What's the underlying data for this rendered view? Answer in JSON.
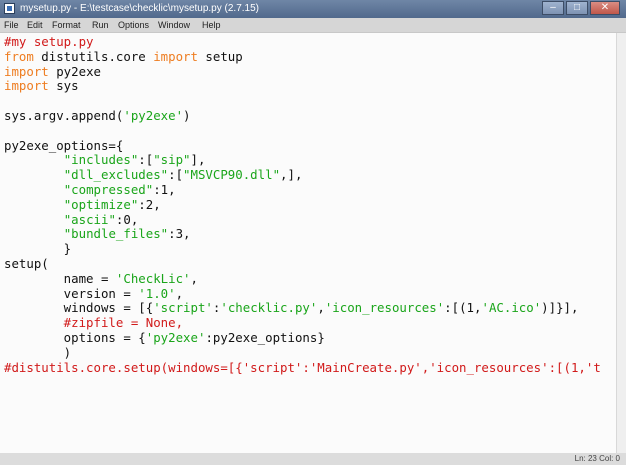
{
  "window": {
    "title": "mysetup.py - E:\\testcase\\checklic\\mysetup.py (2.7.15)",
    "buttons": {
      "minimize": "–",
      "maximize": "□",
      "close": "✕"
    }
  },
  "menu": [
    "File",
    "Edit",
    "Format",
    "Run",
    "Options",
    "Window",
    "Help"
  ],
  "code_lines": [
    [
      {
        "t": "#my setup.py",
        "c": "comment"
      }
    ],
    [
      {
        "t": "from",
        "c": "keyword"
      },
      {
        "t": " distutils.core ",
        "c": "normal"
      },
      {
        "t": "import",
        "c": "keyword"
      },
      {
        "t": " setup",
        "c": "normal"
      }
    ],
    [
      {
        "t": "import",
        "c": "keyword"
      },
      {
        "t": " py2exe",
        "c": "normal"
      }
    ],
    [
      {
        "t": "import",
        "c": "keyword"
      },
      {
        "t": " sys",
        "c": "normal"
      }
    ],
    [],
    [
      {
        "t": "sys.argv.append(",
        "c": "normal"
      },
      {
        "t": "'py2exe'",
        "c": "string"
      },
      {
        "t": ")",
        "c": "normal"
      }
    ],
    [],
    [
      {
        "t": "py2exe_options={",
        "c": "normal"
      }
    ],
    [
      {
        "t": "        ",
        "c": "normal"
      },
      {
        "t": "\"includes\"",
        "c": "string"
      },
      {
        "t": ":[",
        "c": "normal"
      },
      {
        "t": "\"sip\"",
        "c": "string"
      },
      {
        "t": "],",
        "c": "normal"
      }
    ],
    [
      {
        "t": "        ",
        "c": "normal"
      },
      {
        "t": "\"dll_excludes\"",
        "c": "string"
      },
      {
        "t": ":[",
        "c": "normal"
      },
      {
        "t": "\"MSVCP90.dll\"",
        "c": "string"
      },
      {
        "t": ",],",
        "c": "normal"
      }
    ],
    [
      {
        "t": "        ",
        "c": "normal"
      },
      {
        "t": "\"compressed\"",
        "c": "string"
      },
      {
        "t": ":1,",
        "c": "normal"
      }
    ],
    [
      {
        "t": "        ",
        "c": "normal"
      },
      {
        "t": "\"optimize\"",
        "c": "string"
      },
      {
        "t": ":2,",
        "c": "normal"
      }
    ],
    [
      {
        "t": "        ",
        "c": "normal"
      },
      {
        "t": "\"ascii\"",
        "c": "string"
      },
      {
        "t": ":0,",
        "c": "normal"
      }
    ],
    [
      {
        "t": "        ",
        "c": "normal"
      },
      {
        "t": "\"bundle_files\"",
        "c": "string"
      },
      {
        "t": ":3,",
        "c": "normal"
      }
    ],
    [
      {
        "t": "        }",
        "c": "normal"
      }
    ],
    [
      {
        "t": "setup(",
        "c": "normal"
      }
    ],
    [
      {
        "t": "        name = ",
        "c": "normal"
      },
      {
        "t": "'CheckLic'",
        "c": "string"
      },
      {
        "t": ",",
        "c": "normal"
      }
    ],
    [
      {
        "t": "        version = ",
        "c": "normal"
      },
      {
        "t": "'1.0'",
        "c": "string"
      },
      {
        "t": ",",
        "c": "normal"
      }
    ],
    [
      {
        "t": "        windows = [{",
        "c": "normal"
      },
      {
        "t": "'script'",
        "c": "string"
      },
      {
        "t": ":",
        "c": "normal"
      },
      {
        "t": "'checklic.py'",
        "c": "string"
      },
      {
        "t": ",",
        "c": "normal"
      },
      {
        "t": "'icon_resources'",
        "c": "string"
      },
      {
        "t": ":[(1,",
        "c": "normal"
      },
      {
        "t": "'AC.ico'",
        "c": "string"
      },
      {
        "t": ")]}],",
        "c": "normal"
      }
    ],
    [
      {
        "t": "        #zipfile = None,",
        "c": "comment"
      }
    ],
    [
      {
        "t": "        options = {",
        "c": "normal"
      },
      {
        "t": "'py2exe'",
        "c": "string"
      },
      {
        "t": ":py2exe_options}",
        "c": "normal"
      }
    ],
    [
      {
        "t": "        )",
        "c": "normal"
      }
    ],
    [
      {
        "t": "#distutils.core.setup(windows=[{'script':'MainCreate.py','icon_resources':[(1,'t",
        "c": "comment"
      }
    ]
  ],
  "status": {
    "position": "Ln: 23  Col: 0"
  }
}
